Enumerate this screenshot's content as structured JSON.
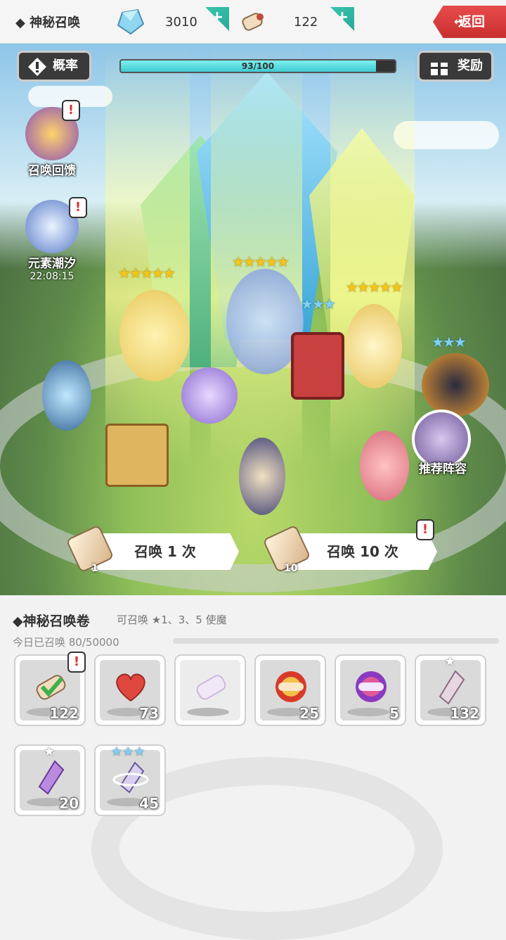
{
  "header": {
    "title": "◆ 神秘召唤",
    "gems": "3010",
    "scrolls": "122",
    "back_label": "返回",
    "back_icon": "↩"
  },
  "scene": {
    "rate_label": "概率",
    "reward_label": "奖励",
    "progress_text": "93/100",
    "progress_value": 0.93,
    "event1_label": "召唤回馈",
    "event2_label": "元素潮汐",
    "event2_timer": "22:08:15",
    "recommend_label": "推荐阵容",
    "summon1": {
      "label": "召唤 1 次",
      "cost": "1"
    },
    "summon10": {
      "label": "召唤 10 次",
      "cost": "10"
    },
    "stars": {
      "mermaid": "★★★★★",
      "minotaur": "★★★★★",
      "queen": "★★★★★",
      "book": "★★★",
      "sun": "★★★"
    }
  },
  "panel": {
    "title": "◆神秘召唤卷",
    "subtitle": "可召唤 ★1、3、5 使魔",
    "today": "今日已召唤 80/50000",
    "slots": [
      {
        "qty": "122",
        "icon": "scroll-check-icon"
      },
      {
        "qty": "73",
        "icon": "heart-icon"
      },
      {
        "qty": "",
        "icon": "purple-scroll-icon"
      },
      {
        "qty": "25",
        "icon": "red-scroll-icon"
      },
      {
        "qty": "5",
        "icon": "purple-orb-scroll-icon"
      },
      {
        "qty": "132",
        "icon": "crystal-shard-icon",
        "tier": "★"
      },
      {
        "qty": "20",
        "icon": "purple-shard-icon",
        "tier": "★"
      },
      {
        "qty": "45",
        "icon": "ring-shard-icon",
        "tier": "★★★"
      }
    ]
  },
  "colors": {
    "accent": "#37c6b0",
    "back": "#d63a3a",
    "progress": "#4fd7dc",
    "star": "#f5c518"
  }
}
